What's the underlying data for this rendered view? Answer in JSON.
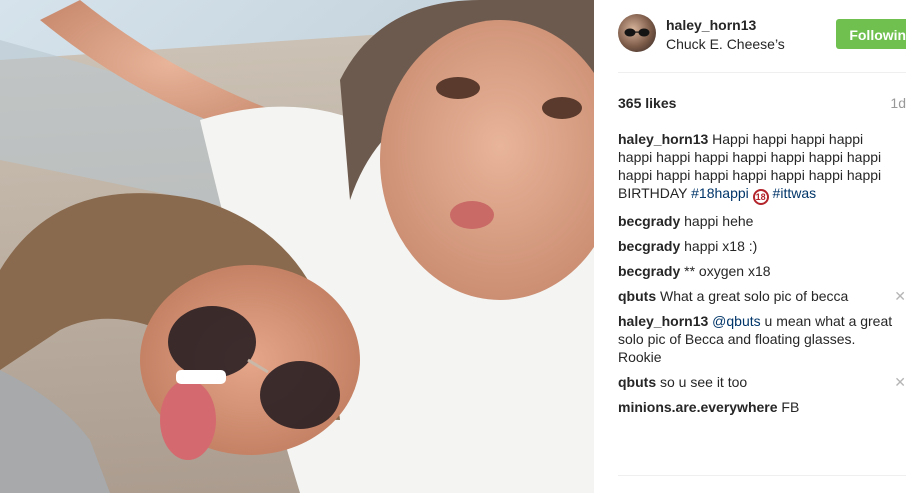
{
  "post": {
    "header": {
      "username": "haley_horn13",
      "location": "Chuck E. Cheese’s",
      "follow_label": "Following"
    },
    "likes": "365 likes",
    "time": "1d",
    "caption": {
      "user": "haley_horn13",
      "text": "Happi happi happi happi happi happi happi happi happi happi happi happi happi happi happi happi happi happi BIRTHDAY",
      "tag1": "#18happi",
      "badge": "18",
      "tag2": "#ittwas"
    },
    "comments": [
      {
        "user": "becgrady",
        "text": "happi hehe",
        "deletable": false
      },
      {
        "user": "becgrady",
        "text": "happi x18 :)",
        "deletable": false
      },
      {
        "user": "becgrady",
        "text": "** oxygen x18",
        "deletable": false
      },
      {
        "user": "qbuts",
        "text": "What a great solo pic of becca",
        "deletable": true
      },
      {
        "user": "haley_horn13",
        "mention": "@qbuts",
        "text": " u mean what a great solo pic of Becca and floating glasses. Rookie",
        "deletable": false
      },
      {
        "user": "qbuts",
        "text": "so u see it too",
        "deletable": true
      },
      {
        "user": "minions.are.everywhere",
        "text": "FB",
        "deletable": false
      }
    ],
    "delete_glyph": "✕"
  },
  "colors": {
    "follow_green": "#70c050",
    "hashtag_blue": "#003569"
  }
}
